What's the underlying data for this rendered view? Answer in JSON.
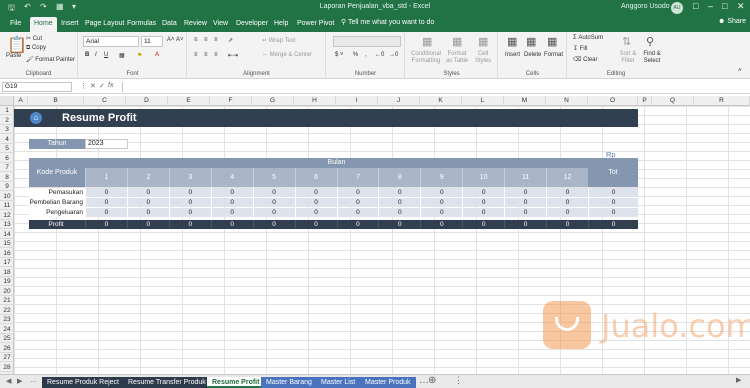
{
  "titlebar": {
    "title": "Laporan Penjualan_vba_std  -  Excel",
    "user": "Anggoro Usodo",
    "avatar_initials": "AU"
  },
  "tabs": [
    "File",
    "Home",
    "Insert",
    "Page Layout",
    "Formulas",
    "Data",
    "Review",
    "View",
    "Developer",
    "Help",
    "Power Pivot"
  ],
  "active_tab": "Home",
  "tell_me": "Tell me what you want to do",
  "share": "Share",
  "ribbon": {
    "clipboard": {
      "paste": "Paste",
      "cut": "Cut",
      "copy": "Copy",
      "format_painter": "Format Painter",
      "label": "Clipboard"
    },
    "font": {
      "name": "Arial",
      "size": "11",
      "label": "Font"
    },
    "alignment": {
      "wrap": "Wrap Text",
      "merge": "Merge & Center",
      "label": "Alignment"
    },
    "number": {
      "label": "Number"
    },
    "styles": {
      "cond": "Conditional Formatting",
      "table": "Format as Table",
      "cell": "Cell Styles",
      "label": "Styles"
    },
    "cells": {
      "insert": "Insert",
      "delete": "Delete",
      "format": "Format",
      "label": "Cells"
    },
    "editing": {
      "autosum": "AutoSum",
      "fill": "Fill",
      "clear": "Clear",
      "sort": "Sort & Filter",
      "find": "Find & Select",
      "label": "Editing"
    }
  },
  "formula_bar": {
    "name_box": "G19",
    "fx": "fx",
    "content": ""
  },
  "columns": [
    "A",
    "B",
    "C",
    "D",
    "E",
    "F",
    "G",
    "H",
    "I",
    "J",
    "K",
    "L",
    "M",
    "N",
    "O",
    "P",
    "Q",
    "R"
  ],
  "rows": [
    "1",
    "2",
    "3",
    "4",
    "5",
    "6",
    "7",
    "8",
    "9",
    "10",
    "11",
    "12",
    "13",
    "14",
    "15",
    "16",
    "17",
    "18",
    "19",
    "20",
    "21",
    "22",
    "23",
    "24",
    "25",
    "26",
    "27",
    "28"
  ],
  "report": {
    "title": "Resume Profit",
    "tahun_label": "Tahun",
    "tahun_value": "2023",
    "currency": "Rp",
    "header_kode": "Kode Produk",
    "header_bulan": "Bulan",
    "header_tot": "Tot",
    "months": [
      "1",
      "2",
      "3",
      "4",
      "5",
      "6",
      "7",
      "8",
      "9",
      "10",
      "11",
      "12"
    ],
    "rows": [
      {
        "label": "Pemasukan",
        "values": [
          "0",
          "0",
          "0",
          "0",
          "0",
          "0",
          "0",
          "0",
          "0",
          "0",
          "0",
          "0",
          "0"
        ]
      },
      {
        "label": "Pembelian Barang",
        "values": [
          "0",
          "0",
          "0",
          "0",
          "0",
          "0",
          "0",
          "0",
          "0",
          "0",
          "0",
          "0",
          "0"
        ]
      },
      {
        "label": "Pengeluaran",
        "values": [
          "0",
          "0",
          "0",
          "0",
          "0",
          "0",
          "0",
          "0",
          "0",
          "0",
          "0",
          "0",
          "0"
        ]
      }
    ],
    "profit": {
      "label": "Profit",
      "values": [
        "0",
        "0",
        "0",
        "0",
        "0",
        "0",
        "0",
        "0",
        "0",
        "0",
        "0",
        "0",
        "0"
      ]
    }
  },
  "sheets": [
    "Resume Produk Reject",
    "Resume Transfer Produk",
    "Resume Profit",
    "Master Barang",
    "Master List",
    "Master Produk"
  ],
  "active_sheet": "Resume Profit",
  "watermark": "Jualo.com",
  "colors": {
    "excel_green": "#217346",
    "banner": "#323f50",
    "header": "#8496b0",
    "light_row": "#dce3ec",
    "sheet_blue": "#4a73bd"
  }
}
